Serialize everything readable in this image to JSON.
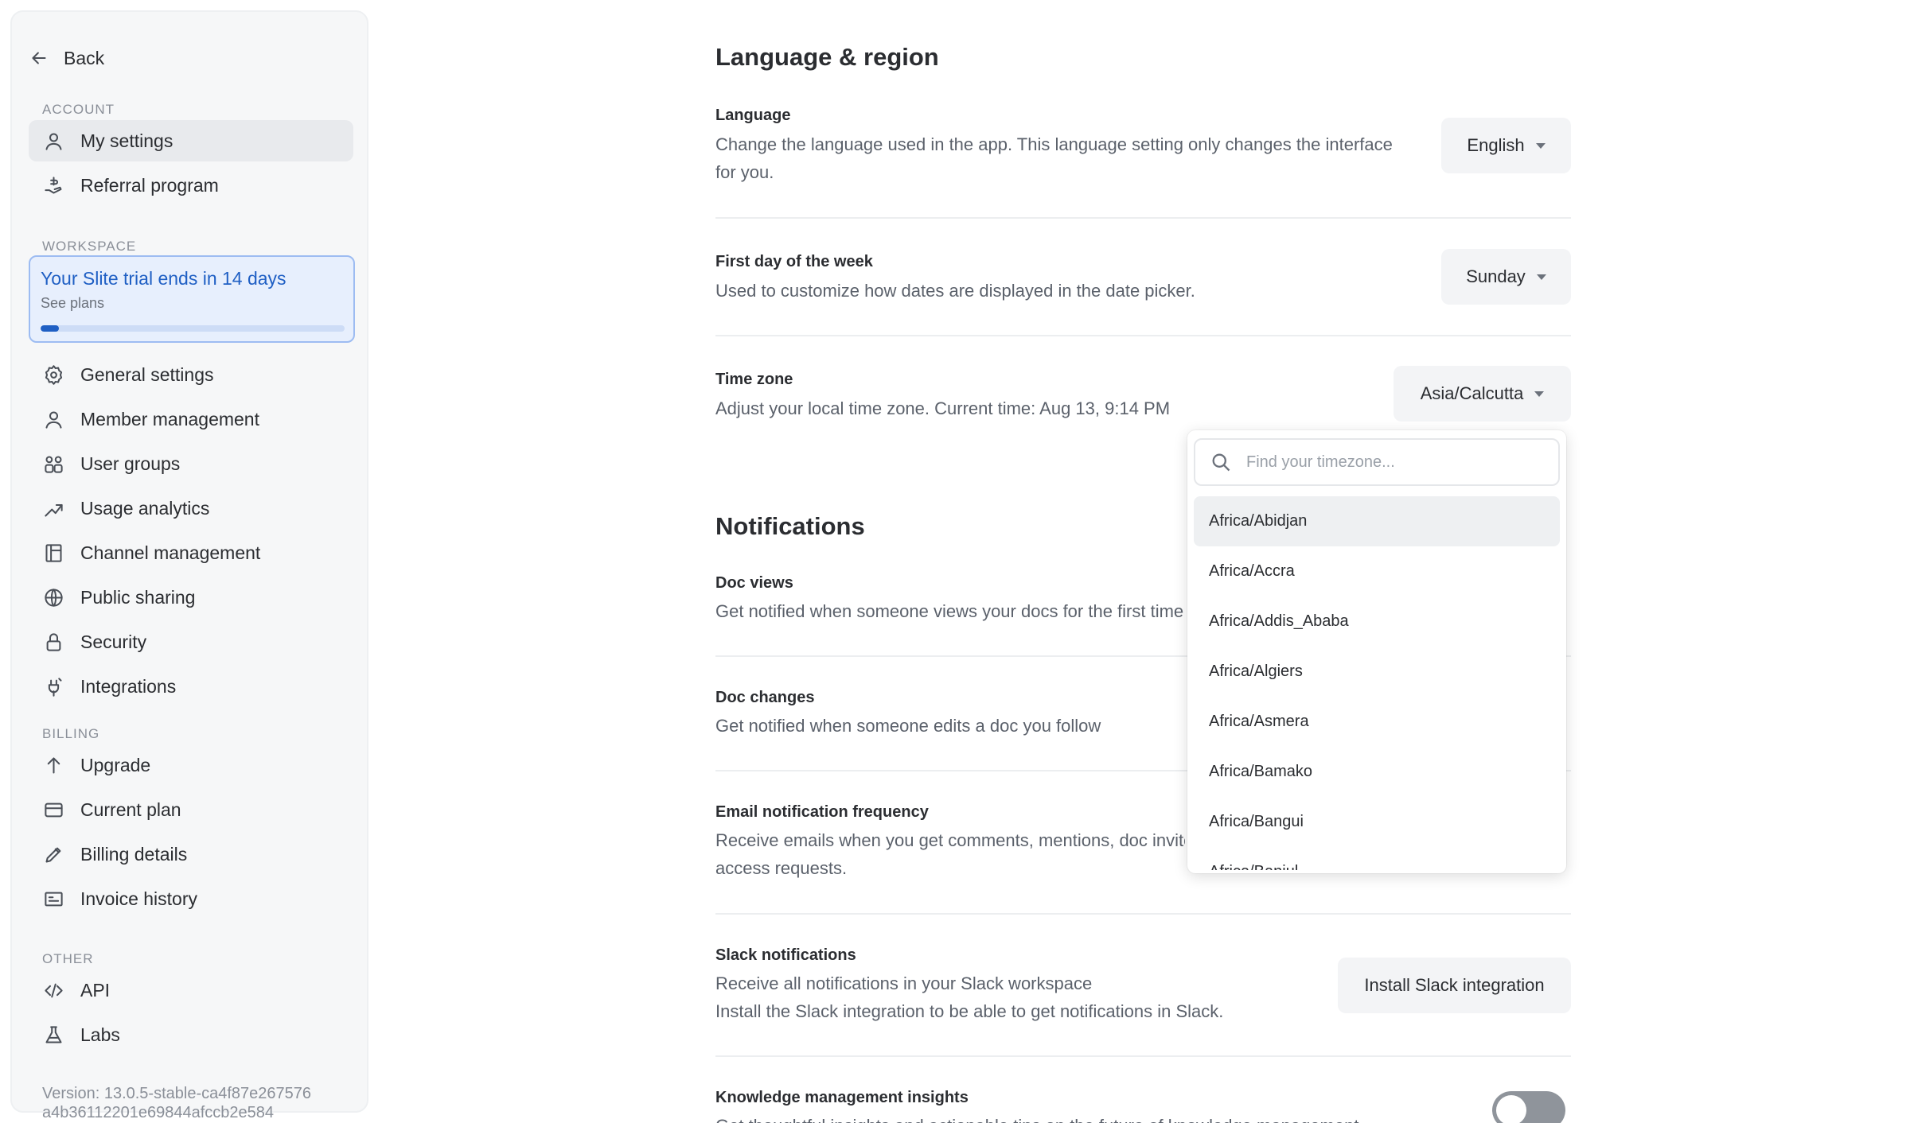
{
  "sidebar": {
    "back_label": "Back",
    "sections": {
      "account": "ACCOUNT",
      "workspace": "WORKSPACE",
      "billing": "BILLING",
      "other": "OTHER"
    },
    "account_items": [
      {
        "label": "My settings",
        "icon": "user-icon"
      },
      {
        "label": "Referral program",
        "icon": "hand-gift-icon"
      }
    ],
    "trial": {
      "title": "Your Slite trial ends in 14 days",
      "subtitle": "See plans",
      "progress": 0.06
    },
    "workspace_items": [
      {
        "label": "General settings",
        "icon": "gear-icon"
      },
      {
        "label": "Member management",
        "icon": "user-icon"
      },
      {
        "label": "User groups",
        "icon": "users-icon"
      },
      {
        "label": "Usage analytics",
        "icon": "trend-icon"
      },
      {
        "label": "Channel management",
        "icon": "layout-icon"
      },
      {
        "label": "Public sharing",
        "icon": "globe-icon"
      },
      {
        "label": "Security",
        "icon": "lock-icon"
      },
      {
        "label": "Integrations",
        "icon": "plug-icon"
      }
    ],
    "billing_items": [
      {
        "label": "Upgrade",
        "icon": "arrow-up-icon"
      },
      {
        "label": "Current plan",
        "icon": "card-icon"
      },
      {
        "label": "Billing details",
        "icon": "pen-icon"
      },
      {
        "label": "Invoice history",
        "icon": "receipt-icon"
      }
    ],
    "other_items": [
      {
        "label": "API",
        "icon": "code-icon"
      },
      {
        "label": "Labs",
        "icon": "flask-icon"
      }
    ],
    "version_line1": "Version: 13.0.5-stable-ca4f87e267576",
    "version_line2": "a4b36112201e69844afccb2e584"
  },
  "main": {
    "language_region": {
      "heading": "Language & region",
      "language": {
        "title": "Language",
        "desc_line1": "Change the language used in the app. This language setting only changes the interface",
        "desc_line2": "for you.",
        "value": "English"
      },
      "first_day": {
        "title": "First day of the week",
        "desc": "Used to customize how dates are displayed in the date picker.",
        "value": "Sunday"
      },
      "timezone": {
        "title": "Time zone",
        "desc": "Adjust your local time zone. Current time: Aug 13, 9:14 PM",
        "value": "Asia/Calcutta"
      }
    },
    "notifications": {
      "heading": "Notifications",
      "doc_views": {
        "title": "Doc views",
        "desc": "Get notified when someone views your docs for the first time"
      },
      "doc_changes": {
        "title": "Doc changes",
        "desc": "Get notified when someone edits a doc you follow"
      },
      "email_freq": {
        "title": "Email notification frequency",
        "desc_line1": "Receive emails when you get comments, mentions, doc invites",
        "desc_line2": "access requests."
      },
      "slack": {
        "title": "Slack notifications",
        "desc_line1": "Receive all notifications in your Slack workspace",
        "desc_line2": "Install the Slack integration to be able to get notifications in Slack.",
        "button": "Install Slack integration"
      },
      "km_insights": {
        "title": "Knowledge management insights",
        "desc": "Get thoughtful insights and actionable tips on the future of knowledge management",
        "enabled": false
      }
    }
  },
  "timezone_dropdown": {
    "search_placeholder": "Find your timezone...",
    "options": [
      "Africa/Abidjan",
      "Africa/Accra",
      "Africa/Addis_Ababa",
      "Africa/Algiers",
      "Africa/Asmera",
      "Africa/Bamako",
      "Africa/Bangui",
      "Africa/Banjul"
    ]
  },
  "colors": {
    "accent": "#1f5fc4",
    "trial_bg": "#e7effd",
    "toggle_off": "#8f949b"
  }
}
